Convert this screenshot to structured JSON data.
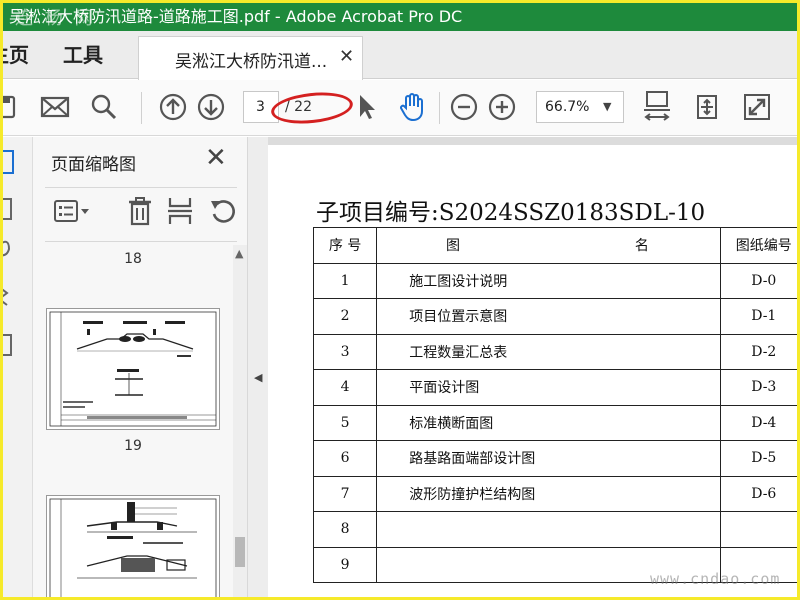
{
  "window": {
    "title": "吴淞江大桥防汛道路-道路施工图.pdf - Adobe Acrobat Pro DC",
    "watermark_top": "连 杨 网",
    "accent": "#1e8a3c"
  },
  "tabs": {
    "home": "主页",
    "tools": "工具",
    "document": "吴淞江大桥防汛道...",
    "close_glyph": "✕"
  },
  "toolbar": {
    "current_page": "3",
    "page_total": "/ 22",
    "zoom": "66.7%",
    "highlight_color": "#d42020",
    "icons": [
      "save-icon",
      "mail-icon",
      "search-icon",
      "prev-page-icon",
      "next-page-icon",
      "select-cursor-icon",
      "hand-tool-icon",
      "zoom-out-icon",
      "zoom-in-icon",
      "fit-page-icon",
      "rotate-view-icon",
      "fullscreen-icon"
    ]
  },
  "thumbnails_panel": {
    "title": "页面缩略图",
    "close_glyph": "✕",
    "page_labels": [
      "18",
      "19"
    ],
    "icons": [
      "thumbnail-options-icon",
      "delete-page-icon",
      "extract-page-icon",
      "rotate-page-icon"
    ]
  },
  "document": {
    "subtitle": "子项目编号:S2024SSZ0183SDL-10",
    "table": {
      "headers": {
        "no": "序 号",
        "name_left": "图",
        "name_right": "名",
        "code": "图纸编号"
      },
      "rows": [
        {
          "no": "1",
          "name": "施工图设计说明",
          "code": "D-0"
        },
        {
          "no": "2",
          "name": "项目位置示意图",
          "code": "D-1"
        },
        {
          "no": "3",
          "name": "工程数量汇总表",
          "code": "D-2"
        },
        {
          "no": "4",
          "name": "平面设计图",
          "code": "D-3"
        },
        {
          "no": "5",
          "name": "标准横断面图",
          "code": "D-4"
        },
        {
          "no": "6",
          "name": "路基路面端部设计图",
          "code": "D-5"
        },
        {
          "no": "7",
          "name": "波形防撞护栏结构图",
          "code": "D-6"
        },
        {
          "no": "8",
          "name": "",
          "code": ""
        },
        {
          "no": "9",
          "name": "",
          "code": ""
        }
      ]
    }
  },
  "watermark_bottom": "www.cndao.com"
}
